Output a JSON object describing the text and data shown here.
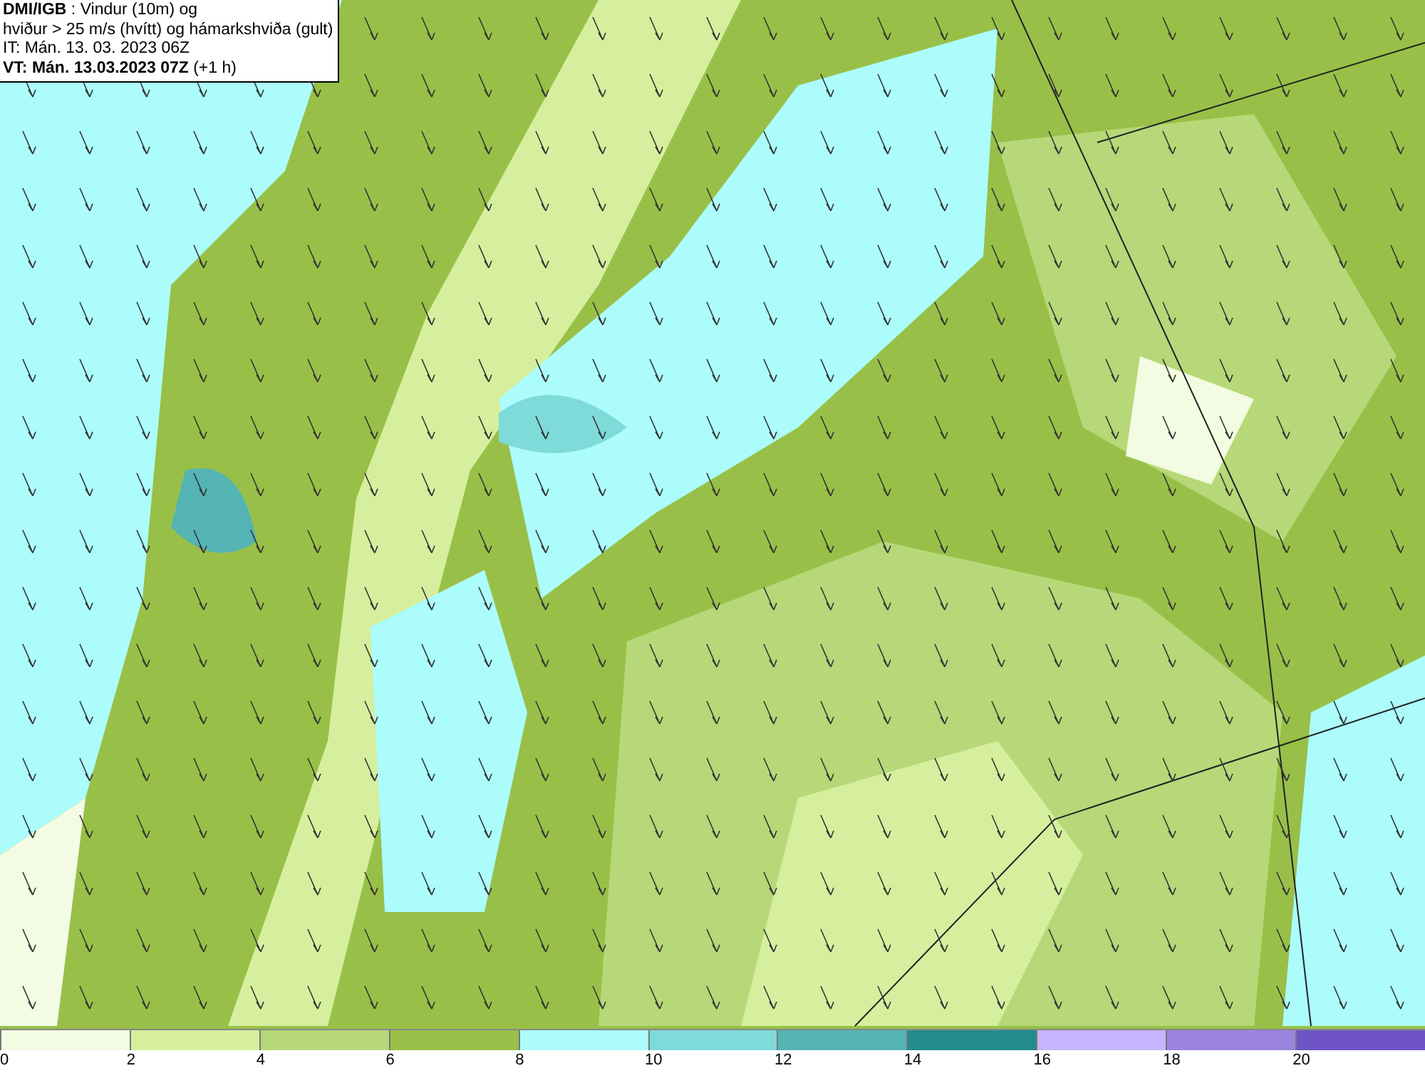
{
  "header": {
    "lines": [
      "**DMI/IGB** : Vindur (10m) og",
      "hviður > 25 m/s (hvítt) og hámarkshviða (gult)",
      "IT: Mán. 13. 03. 2023 06Z",
      "**VT: Mán. 13.03.2023 07Z** (+1 h)"
    ]
  },
  "legend": [
    {
      "label": "0",
      "color": "#f3fbe2"
    },
    {
      "label": "2",
      "color": "#d6ef9e"
    },
    {
      "label": "4",
      "color": "#b6d878"
    },
    {
      "label": "6",
      "color": "#98c048"
    },
    {
      "label": "8",
      "color": "#acfcfc"
    },
    {
      "label": "10",
      "color": "#7fdada"
    },
    {
      "label": "12",
      "color": "#55b4b4"
    },
    {
      "label": "14",
      "color": "#228c8c"
    },
    {
      "label": "16",
      "color": "#c6b4fc"
    },
    {
      "label": "18",
      "color": "#9a84e0"
    },
    {
      "label": "20",
      "color": "#6e54c4"
    }
  ]
}
